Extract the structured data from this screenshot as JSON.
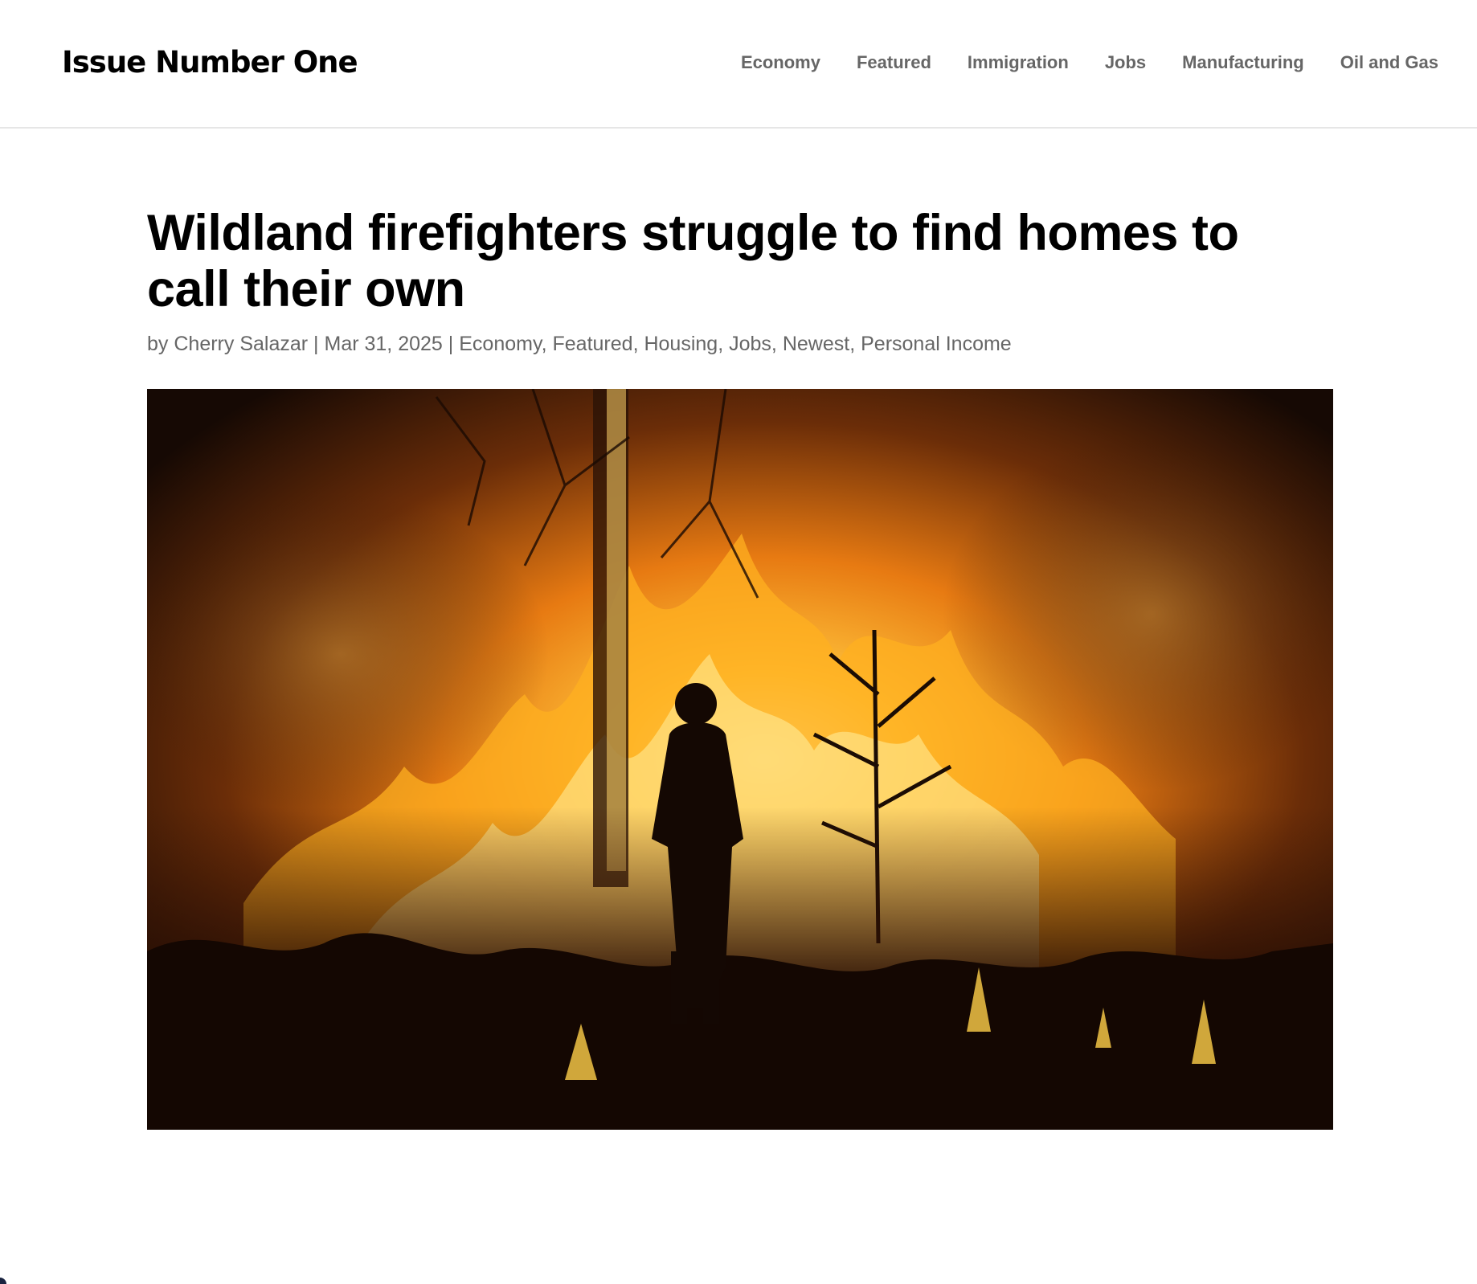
{
  "site": {
    "name": "Issue Number One"
  },
  "nav": {
    "items": [
      {
        "label": "Economy"
      },
      {
        "label": "Featured"
      },
      {
        "label": "Immigration"
      },
      {
        "label": "Jobs"
      },
      {
        "label": "Manufacturing"
      },
      {
        "label": "Oil and Gas"
      }
    ]
  },
  "article": {
    "title": "Wildland firefighters struggle to find homes to call their own",
    "byline_prefix": "by",
    "author": "Cherry Salazar",
    "separator": "|",
    "date": "Mar 31, 2025",
    "categories": [
      {
        "label": "Economy"
      },
      {
        "label": "Featured"
      },
      {
        "label": "Housing"
      },
      {
        "label": "Jobs"
      },
      {
        "label": "Newest"
      },
      {
        "label": "Personal Income"
      }
    ],
    "hero_image": {
      "icon": "wildfire-photo"
    }
  },
  "colors": {
    "nav_text": "#666666",
    "title_text": "#000000",
    "meta_text": "#666666",
    "divider": "#e6e6e6"
  }
}
